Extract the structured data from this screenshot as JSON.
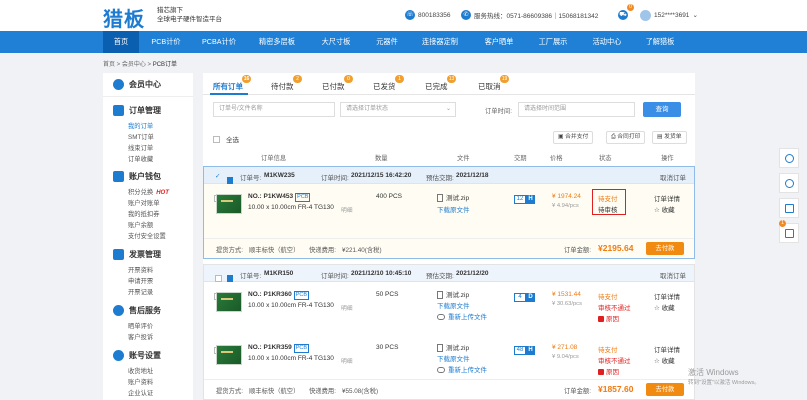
{
  "header": {
    "logo": "猎板",
    "sub_line1": "猎芯旗下",
    "sub_line2": "全球电子硬件智造平台",
    "phone": "800183356",
    "service": "服务热线：0571-86609386｜15068181342",
    "cart_count": "0",
    "user": "152****3691"
  },
  "nav": {
    "items": [
      "首页",
      "PCB计价",
      "PCBA计价",
      "精密多层板",
      "大尺寸板",
      "元器件",
      "连接器定制",
      "客户晒单",
      "工厂展示",
      "活动中心",
      "了解猎板"
    ]
  },
  "breadcrumb": [
    "首页",
    "会员中心",
    "PCB订单"
  ],
  "sidebar": {
    "member_center": "会员中心",
    "order_mgmt": "订单管理",
    "order_links": [
      "我的订单",
      "SMT订单",
      "线束订单",
      "订单收藏"
    ],
    "wallet": "账户钱包",
    "wallet_links": [
      "积分兑换",
      "账户对账单",
      "我的抵扣券",
      "账户余额",
      "支付安全设置"
    ],
    "hot": "HOT",
    "invoice": "发票管理",
    "invoice_links": [
      "开票资料",
      "申请开票",
      "开票记录"
    ],
    "after_sale": "售后服务",
    "after_links": [
      "晒单评价",
      "客户投诉"
    ],
    "account": "账号设置",
    "account_links": [
      "收货地址",
      "账户资料",
      "企业认证"
    ]
  },
  "tabs": [
    {
      "label": "所有订单",
      "badge": "16"
    },
    {
      "label": "待付款",
      "badge": "2"
    },
    {
      "label": "已付款",
      "badge": "0"
    },
    {
      "label": "已发货",
      "badge": "1"
    },
    {
      "label": "已完成",
      "badge": "13"
    },
    {
      "label": "已取消",
      "badge": "19"
    }
  ],
  "filters": {
    "order_no_placeholder": "订单号/文件名称",
    "status_placeholder": "请选择订单状态",
    "time_label": "订单时间:",
    "time_placeholder": "请选择时间范围",
    "query": "查询"
  },
  "toolbar": {
    "select_all": "全选",
    "merge_pay": "合并支付",
    "merge_print": "合同打印",
    "invoice": "发货单"
  },
  "columns": [
    "订单信息",
    "数量",
    "文件",
    "交期",
    "价格",
    "状态",
    "操作"
  ],
  "orders": [
    {
      "order_no_label": "订单号:",
      "order_no": "M1KW235",
      "time_label": "订单时间:",
      "time": "2021/12/15 16:42:20",
      "delivery_label": "预估交期:",
      "delivery": "2021/12/18",
      "cancel": "取消订单",
      "items": [
        {
          "no": "NO.: P1KW453",
          "tag": "PCB",
          "spec": "10.00 x 10.00cm FR-4 TG130",
          "note": "明细",
          "qty": "400 PCS",
          "file": "测试.zip",
          "file_action": "下载原文件",
          "days": "12",
          "unit": "H",
          "price": "¥ 1974.24",
          "unit_price": "¥ 4.94/pcs",
          "status1": "待支付",
          "status2": "待审核",
          "op1": "订单详情",
          "op2": "收藏"
        }
      ],
      "ship_label": "提货方式:",
      "ship": "顺丰标快（航空）",
      "fee_label": "快递费用:",
      "fee": "¥221.40(含税)",
      "total_label": "订单金额:",
      "total": "¥2195.64",
      "pay": "去付款"
    },
    {
      "order_no_label": "订单号:",
      "order_no": "M1KR150",
      "time_label": "订单时间:",
      "time": "2021/12/10 10:45:10",
      "delivery_label": "预估交期:",
      "delivery": "2021/12/20",
      "cancel": "取消订单",
      "items": [
        {
          "no": "NO.: P1KR360",
          "tag": "PCB",
          "spec": "10.00 x 10.00cm FR-4 TG130",
          "note": "明细",
          "qty": "50 PCS",
          "file": "测试.zip",
          "file_action": "下载原文件",
          "reupload": "重新上传文件",
          "days": "4",
          "unit": "D",
          "price": "¥ 1531.44",
          "unit_price": "¥ 30.63/pcs",
          "status1": "待支付",
          "status2": "审核不通过",
          "reason": "原因",
          "op1": "订单详情",
          "op2": "收藏"
        },
        {
          "no": "NO.: P1KR359",
          "tag": "PCB",
          "spec": "10.00 x 10.00cm FR-4 TG130",
          "note": "明细",
          "qty": "30 PCS",
          "file": "测试.zip",
          "file_action": "下载原文件",
          "reupload": "重新上传文件",
          "days": "48",
          "unit": "H",
          "price": "¥ 271.08",
          "unit_price": "¥ 9.04/pcs",
          "status1": "待支付",
          "status2": "审核不通过",
          "reason": "原因",
          "op1": "订单详情",
          "op2": "收藏"
        }
      ],
      "ship_label": "提货方式:",
      "ship": "顺丰标快（航空）",
      "fee_label": "快递费用:",
      "fee": "¥55.08(含税)",
      "total_label": "订单金额:",
      "total": "¥1857.60",
      "pay": "去付款"
    }
  ],
  "watermark": {
    "line1": "激活 Windows",
    "line2": "转到\"设置\"以激活 Windows。"
  },
  "float_count": "1",
  "colors": {
    "primary": "#1f80d6",
    "accent": "#f08a10",
    "danger": "#e02020"
  }
}
